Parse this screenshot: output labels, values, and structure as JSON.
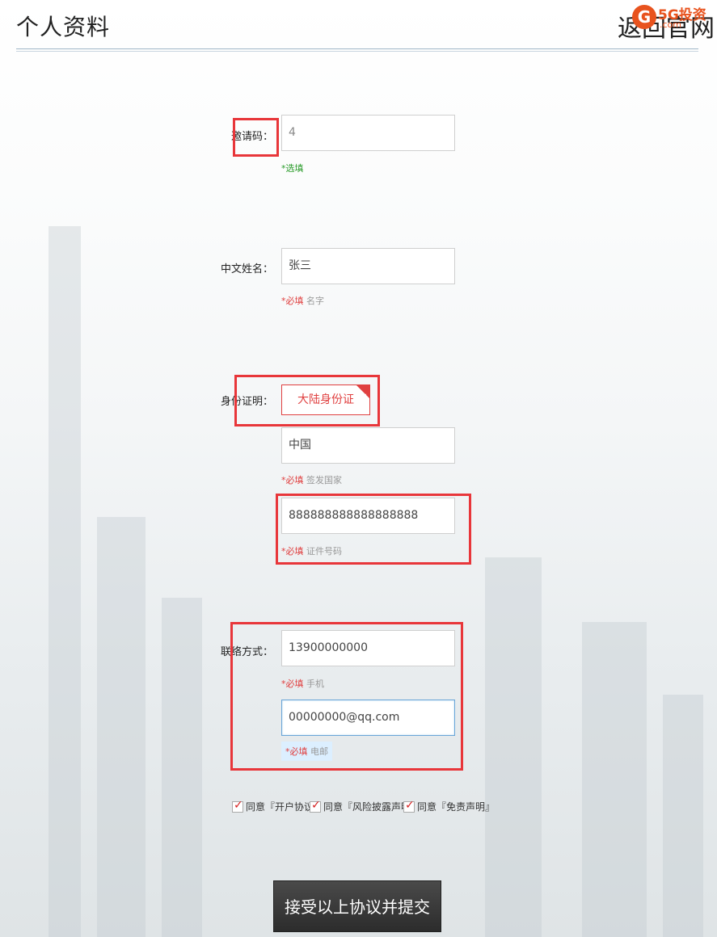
{
  "header": {
    "title": "个人资料",
    "back_label": "返回官网",
    "logo_mark": "G",
    "logo_text": "5G投资",
    "logo_domain": ".com"
  },
  "form": {
    "invite": {
      "label": "邀请码：",
      "value": "4",
      "hint": "*选填"
    },
    "chinese_name": {
      "label": "中文姓名：",
      "value": "张三",
      "hint_required": "*必填",
      "hint_text": " 名字"
    },
    "id_proof": {
      "label": "身份证明：",
      "selected_option": "大陆身份证",
      "country": {
        "value": "中国",
        "hint_required": "*必填",
        "hint_text": " 签发国家"
      },
      "number": {
        "value": "888888888888888888",
        "hint_required": "*必填",
        "hint_text": " 证件号码"
      }
    },
    "contact": {
      "label": "联络方式：",
      "phone": {
        "value": "13900000000",
        "hint_required": "*必填",
        "hint_text": " 手机"
      },
      "email": {
        "value": "00000000@qq.com",
        "hint_required": "*必填",
        "hint_text": " 电邮"
      }
    }
  },
  "agreements": [
    {
      "label": "同意『开户协议』",
      "checked": true
    },
    {
      "label": "同意『风险披露声明』",
      "checked": true
    },
    {
      "label": "同意『免责声明』",
      "checked": true
    }
  ],
  "submit_label": "接受以上协议并提交",
  "colors": {
    "accent_red": "#e8363a",
    "required_red": "#e04040",
    "optional_green": "#2a9b2a",
    "logo_orange": "#e8531e"
  }
}
